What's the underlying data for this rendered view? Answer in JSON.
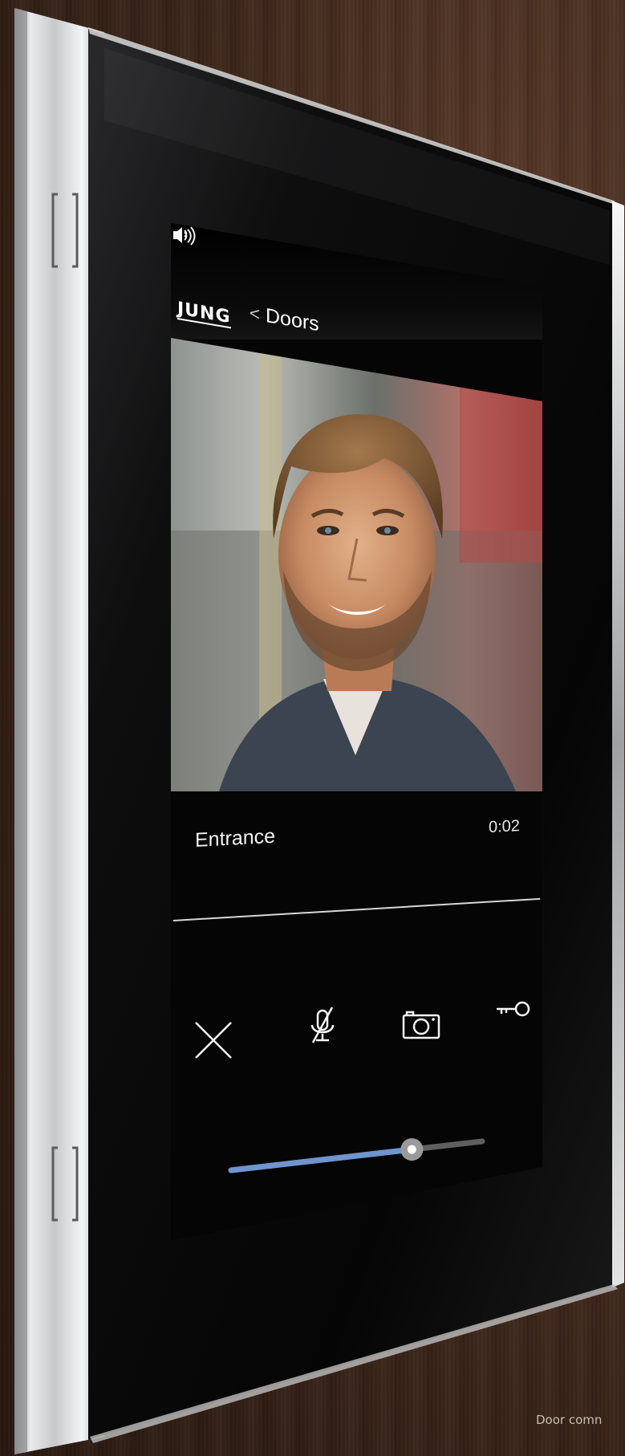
{
  "header": {
    "logo_text": "JUNG",
    "back_chevron": "<",
    "breadcrumb": "Doors"
  },
  "call": {
    "station_name": "Entrance",
    "duration": "0:02"
  },
  "controls": {
    "hangup_icon": "close-x-icon",
    "mute_icon": "microphone-muted-icon",
    "snapshot_icon": "camera-icon",
    "door_icon": "key-icon"
  },
  "volume": {
    "level": 0.72,
    "low_icon": "speaker-low-icon",
    "high_icon": "speaker-high-icon"
  },
  "colors": {
    "accent": "#6f95cf",
    "track": "#5f5f5f",
    "screen_bg": "#050505"
  },
  "caption": {
    "text": "Door comn"
  }
}
